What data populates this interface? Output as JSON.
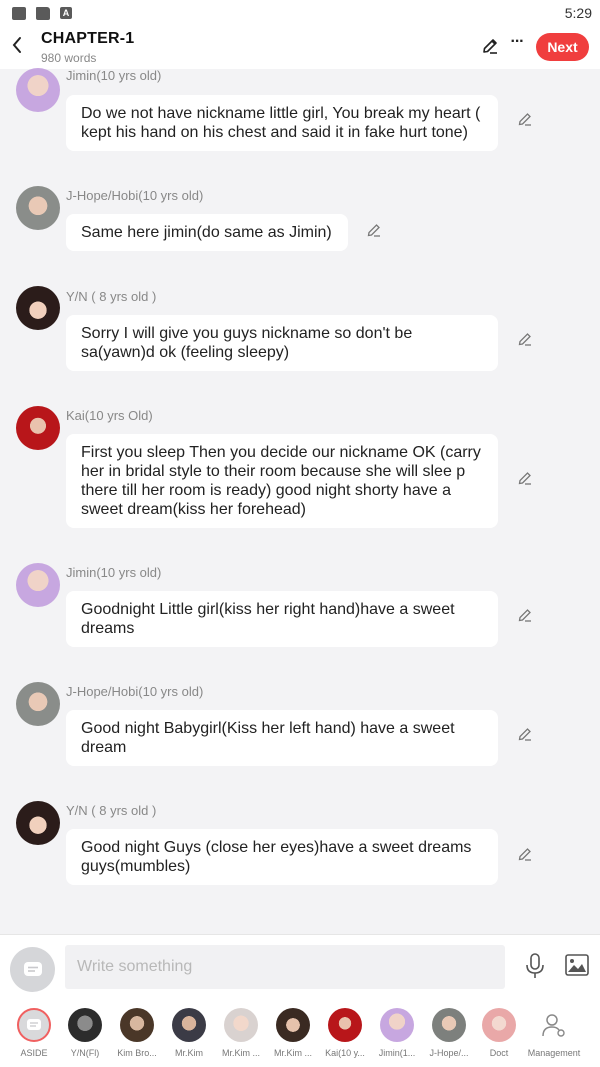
{
  "status_bar": {
    "time": "5:29",
    "icons": [
      "image-icon",
      "folder-icon",
      "a-icon"
    ]
  },
  "header": {
    "title": "CHAPTER-1",
    "word_count": "980 words",
    "next_label": "Next",
    "more_label": "···",
    "accent_color": "#f03e3e"
  },
  "messages": [
    {
      "name": "Jimin(10 yrs old)",
      "text": "Do we not have nickname little girl, You break my heart ( kept his hand on his chest and said it in fake hurt tone)"
    },
    {
      "name": "J-Hope/Hobi(10 yrs old)",
      "text": "Same here jimin(do same as Jimin)"
    },
    {
      "name": "Y/N ( 8 yrs old )",
      "text": "Sorry I will give you guys nickname so don't be sa(yawn)d ok (feeling sleepy)"
    },
    {
      "name": "Kai(10 yrs Old)",
      "text": "First you sleep Then you decide our nickname OK (carry her in bridal style  to their room because she will slee p there till her room is ready) good night shorty have a sweet dream(kiss her forehead)"
    },
    {
      "name": "Jimin(10 yrs old)",
      "text": "Goodnight Little girl(kiss her right hand)have a sweet dreams"
    },
    {
      "name": "J-Hope/Hobi(10 yrs old)",
      "text": "Good night Babygirl(Kiss her left hand) have a sweet dream"
    },
    {
      "name": "Y/N ( 8 yrs old )",
      "text": "Good night Guys (close her eyes)have a sweet dreams guys(mumbles)"
    }
  ],
  "input": {
    "placeholder": "Write something"
  },
  "characters": [
    {
      "label": "ASIDE"
    },
    {
      "label": "Y/N(Fl)"
    },
    {
      "label": "Kim Bro..."
    },
    {
      "label": "Mr.Kim"
    },
    {
      "label": "Mr.Kim ..."
    },
    {
      "label": "Mr.Kim ..."
    },
    {
      "label": "Kai(10 y..."
    },
    {
      "label": "Jimin(1..."
    },
    {
      "label": "J-Hope/..."
    },
    {
      "label": "Doct"
    },
    {
      "label": "Management"
    }
  ]
}
